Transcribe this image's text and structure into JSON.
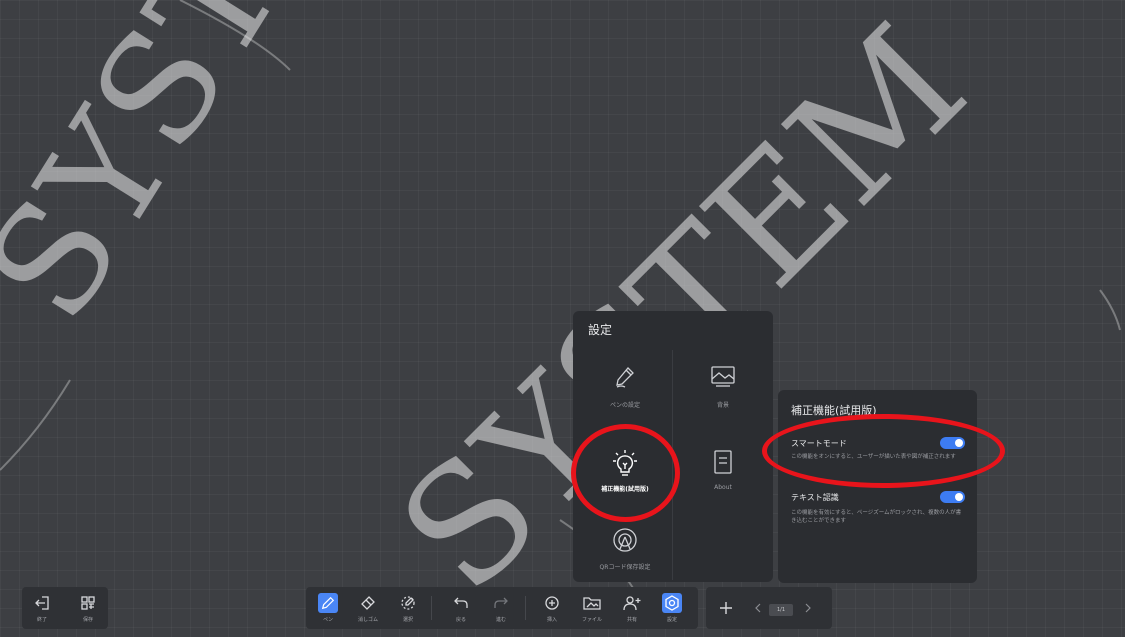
{
  "watermark": {
    "text_left": "SYST",
    "text_right": "SYSTEM",
    "letter_s_right": "S"
  },
  "settings_panel": {
    "title": "設定",
    "items": [
      {
        "label": "ペンの設定",
        "icon": "pen-icon"
      },
      {
        "label": "背景",
        "icon": "background-image-icon"
      },
      {
        "label": "補正機能(試用版)",
        "icon": "lightbulb-icon",
        "active": true
      },
      {
        "label": "About",
        "icon": "document-icon"
      },
      {
        "label": "QRコード保存設定",
        "icon": "qr-broadcast-icon"
      }
    ]
  },
  "correction_panel": {
    "title": "補正機能(試用版)",
    "options": [
      {
        "name": "スマートモード",
        "desc": "この機能をオンにすると、ユーザーが描いた表や図が補正されます",
        "enabled": true
      },
      {
        "name": "テキスト認識",
        "desc": "この機能を有効にすると、ページズームがロックされ、複数の人が書き込むことができます",
        "enabled": true
      }
    ]
  },
  "toolbar_left": [
    {
      "label": "終了",
      "icon": "exit-icon"
    },
    {
      "label": "保存",
      "icon": "save-grid-icon"
    }
  ],
  "toolbar_main": [
    {
      "label": "ペン",
      "icon": "pen-icon",
      "active": true
    },
    {
      "label": "消しゴム",
      "icon": "eraser-icon"
    },
    {
      "label": "選択",
      "icon": "lasso-select-icon"
    },
    {
      "label": "戻る",
      "icon": "undo-icon"
    },
    {
      "label": "進む",
      "icon": "redo-icon"
    },
    {
      "label": "挿入",
      "icon": "insert-icon"
    },
    {
      "label": "ファイル",
      "icon": "folder-icon"
    },
    {
      "label": "共有",
      "icon": "share-user-icon"
    },
    {
      "label": "設定",
      "icon": "settings-icon",
      "active": true
    }
  ],
  "page_nav": {
    "add_icon": "plus-icon",
    "prev_icon": "chevron-left-icon",
    "next_icon": "chevron-right-icon",
    "page": "1/1"
  },
  "colors": {
    "accent": "#4a86f5",
    "annotation": "#e8141b",
    "panel": "#2b2d31"
  }
}
